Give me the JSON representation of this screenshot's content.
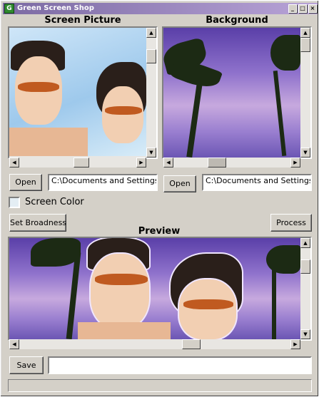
{
  "window": {
    "title": "Green Screen Shop",
    "controls": {
      "minimize": "_",
      "maximize": "□",
      "close": "×"
    }
  },
  "screen_picture": {
    "heading": "Screen Picture",
    "open_button": "Open",
    "path": "C:\\Documents and Settings\\kei"
  },
  "background": {
    "heading": "Background",
    "open_button": "Open",
    "path": "C:\\Documents and Settings\\kei"
  },
  "screen_color": {
    "label": "Screen Color",
    "swatch_color": "#e4eef4"
  },
  "actions": {
    "set_broadness": "Set Broadness",
    "process": "Process"
  },
  "preview": {
    "heading": "Preview"
  },
  "save": {
    "button": "Save",
    "filename": ""
  },
  "icons": {
    "app": "green-screen-app-icon",
    "scroll_up": "arrow-up-icon",
    "scroll_down": "arrow-down-icon",
    "scroll_left": "arrow-left-icon",
    "scroll_right": "arrow-right-icon"
  }
}
